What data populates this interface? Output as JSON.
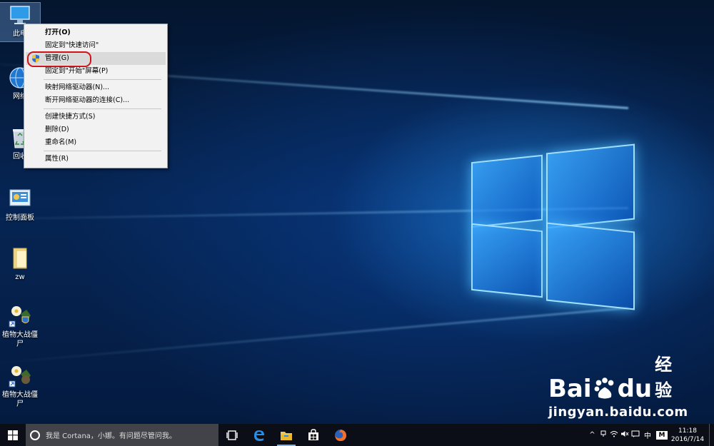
{
  "desktop_icons": [
    {
      "label": "此电",
      "icon": "this-pc-icon"
    },
    {
      "label": "网络",
      "icon": "network-icon"
    },
    {
      "label": "回收",
      "icon": "recycle-bin-icon"
    },
    {
      "label": "控制面板",
      "icon": "control-panel-icon"
    },
    {
      "label": "zw",
      "icon": "folder-icon"
    },
    {
      "label": "植物大战僵尸",
      "icon": "game-shortcut-icon"
    },
    {
      "label": "植物大战僵尸",
      "icon": "game-shortcut-icon"
    }
  ],
  "context_menu": {
    "items": [
      {
        "label": "打开(O)"
      },
      {
        "label": "固定到\"快速访问\""
      },
      {
        "label": "管理(G)",
        "icon": "uac-shield-icon"
      },
      {
        "label": "固定到\"开始\"屏幕(P)"
      },
      {
        "label": "映射网络驱动器(N)..."
      },
      {
        "label": "断开网络驱动器的连接(C)..."
      },
      {
        "label": "创建快捷方式(S)"
      },
      {
        "label": "删除(D)"
      },
      {
        "label": "重命名(M)"
      },
      {
        "label": "属性(R)"
      }
    ],
    "highlight_color": "#d0121b"
  },
  "taskbar": {
    "search_placeholder": "我是 Cortana，小娜。有问题尽管问我。",
    "apps": [
      "task-view-icon",
      "edge-icon",
      "file-explorer-icon",
      "store-icon",
      "firefox-icon"
    ],
    "tray": {
      "icons": [
        "chevron-up-icon",
        "network-icon",
        "volume-icon",
        "action-center-icon"
      ],
      "ime_lang": "中",
      "ime_mode": "M",
      "time": "11:18",
      "date": "2016/7/14"
    }
  },
  "watermark": {
    "brand": "Bai",
    "brand2": "du",
    "suffix": "经验",
    "url": "jingyan.baidu.com"
  },
  "colors": {
    "accent": "#7fb4e8",
    "menu_bg": "#f2f2f2",
    "taskbar_bg": "#0c0e14"
  }
}
